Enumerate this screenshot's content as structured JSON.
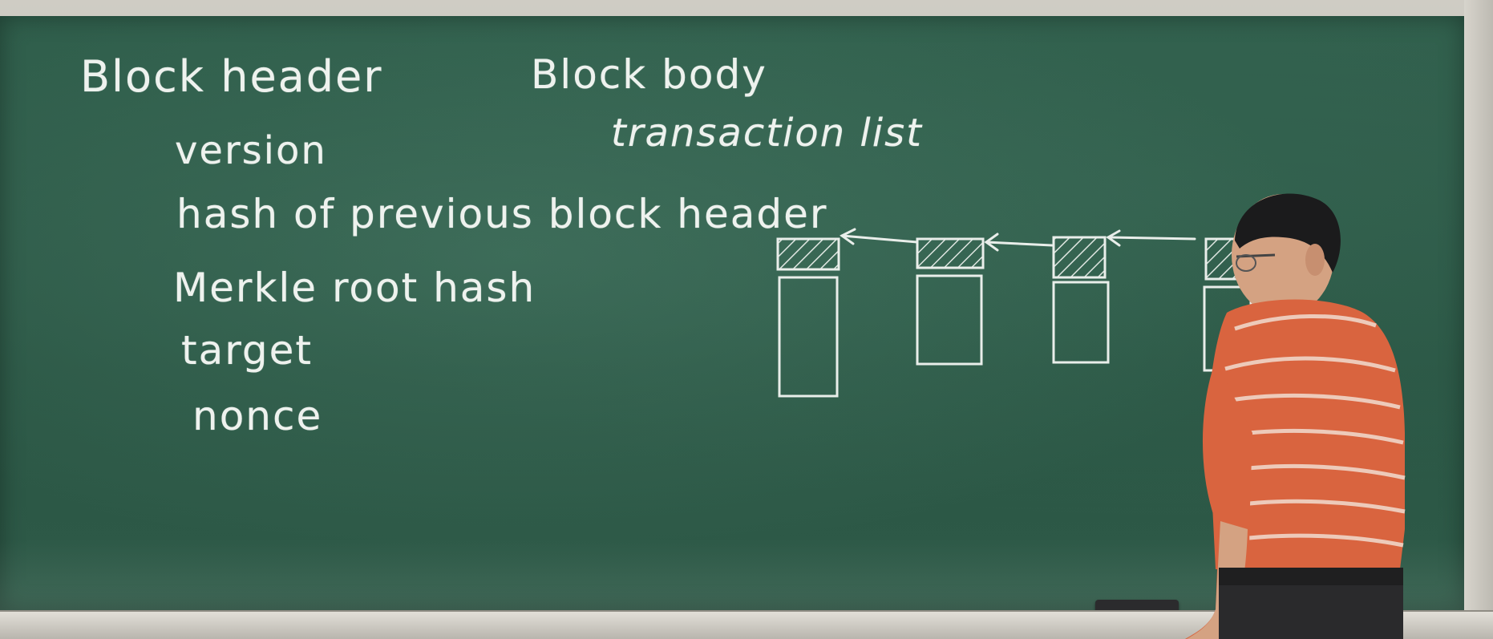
{
  "board": {
    "header_title": "Block header",
    "body_title": "Block body",
    "body_item": "transaction list",
    "header_fields": [
      "version",
      "hash of previous block header",
      "Merkle root hash",
      "target",
      "nonce"
    ]
  },
  "colors": {
    "board": "#2c5a47",
    "chalk": "#eef2ee",
    "shirt": "#d9643f",
    "frame": "#c4c1b9"
  },
  "diagram": {
    "blocks": 4,
    "arrows": 3
  }
}
